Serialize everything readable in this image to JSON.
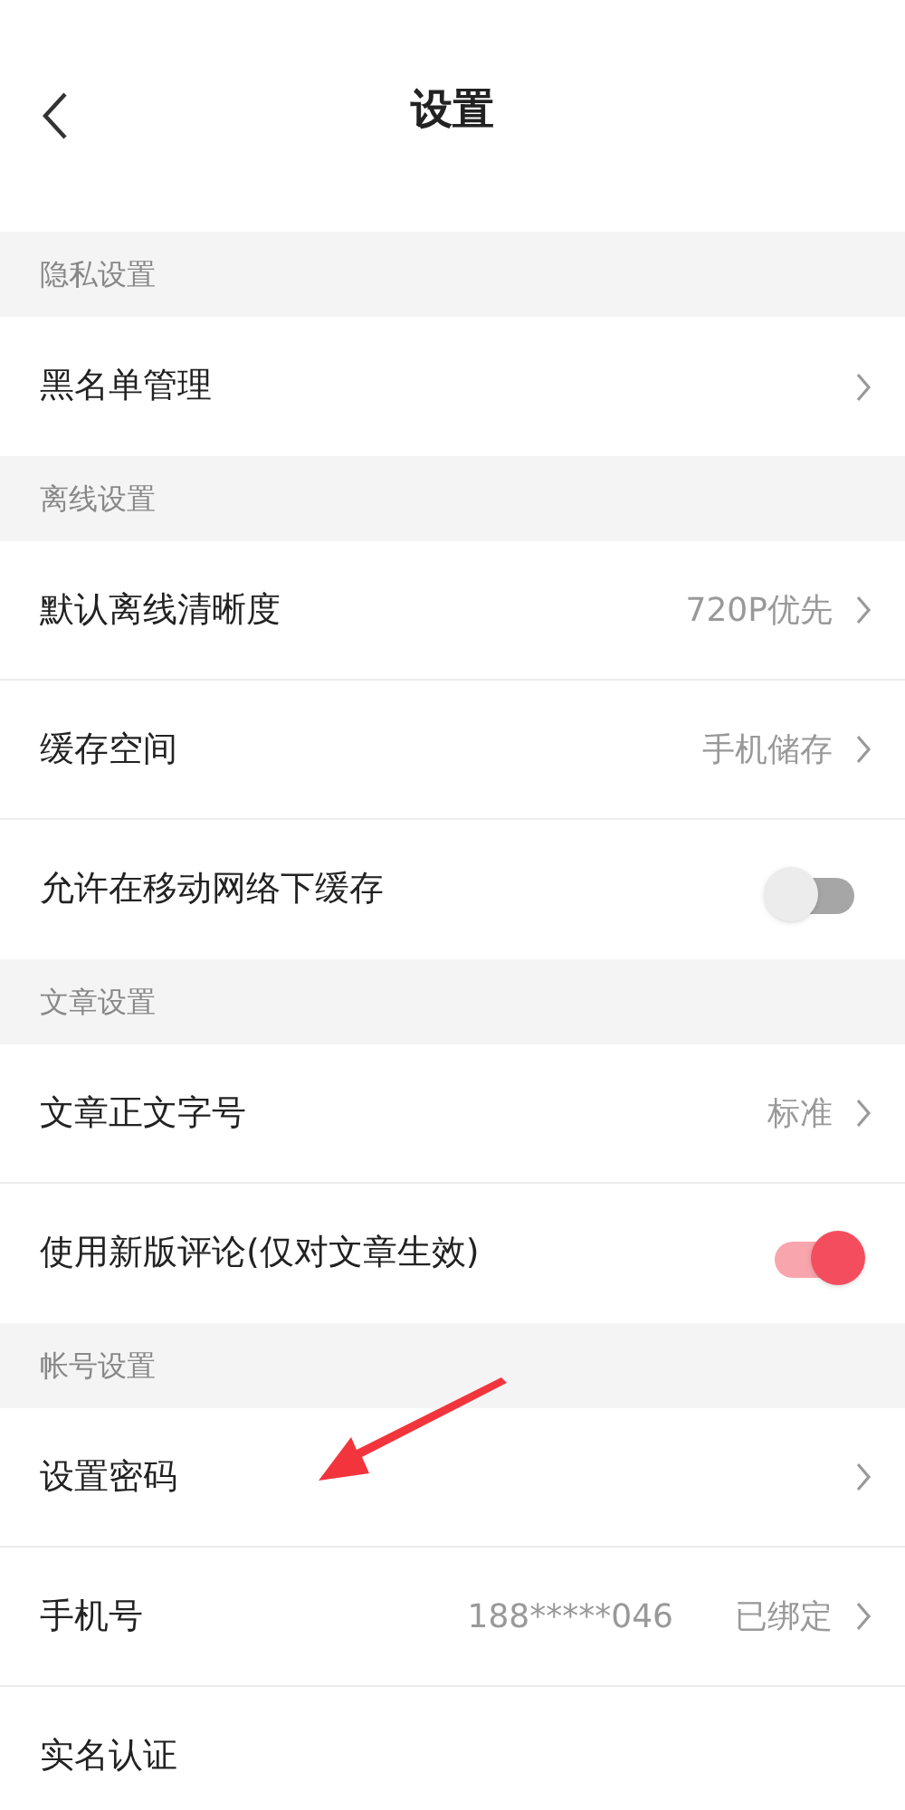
{
  "header": {
    "title": "设置"
  },
  "sections": [
    {
      "title": "隐私设置",
      "rows": [
        {
          "kind": "link",
          "label": "黑名单管理"
        }
      ]
    },
    {
      "title": "离线设置",
      "rows": [
        {
          "kind": "link",
          "label": "默认离线清晰度",
          "value": "720P优先"
        },
        {
          "kind": "link",
          "label": "缓存空间",
          "value": "手机储存"
        },
        {
          "kind": "toggle",
          "label": "允许在移动网络下缓存",
          "on": false
        }
      ]
    },
    {
      "title": "文章设置",
      "rows": [
        {
          "kind": "link",
          "label": "文章正文字号",
          "value": "标准"
        },
        {
          "kind": "toggle",
          "label": "使用新版评论(仅对文章生效)",
          "on": true
        }
      ]
    },
    {
      "title": "帐号设置",
      "rows": [
        {
          "kind": "link",
          "label": "设置密码"
        },
        {
          "kind": "link",
          "label": "手机号",
          "extra": "188*****046",
          "value": "已绑定"
        },
        {
          "kind": "plain",
          "label": "实名认证"
        }
      ]
    }
  ]
}
